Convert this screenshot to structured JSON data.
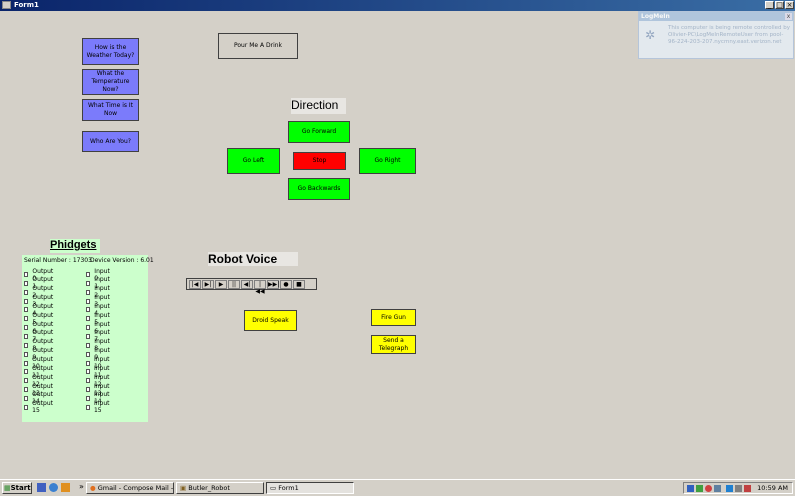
{
  "window": {
    "title": "Form1",
    "min": "_",
    "max": "□",
    "close": "×"
  },
  "menu_buttons": {
    "weather": "How is the Weather Today?",
    "temperature": "What the Temperature Now?",
    "time": "What Time is It Now",
    "who": "Who Are You?",
    "drink": "Pour Me A Drink"
  },
  "direction": {
    "heading": "Direction",
    "forward": "Go Forward",
    "left": "Go Left",
    "stop": "Stop",
    "right": "Go Right",
    "backward": "Go Backwards"
  },
  "phidgets": {
    "heading": "Phidgets",
    "serial": "Serial Number : 17303",
    "version": "Device Version : 6.01",
    "outputs": [
      "Output 0",
      "Output 1",
      "Output 2",
      "Output 3",
      "Output 4",
      "Output 5",
      "Output 6",
      "Output 7",
      "Output 8",
      "Output 9",
      "Output 10",
      "Output 11",
      "Output 12",
      "Output 13",
      "Output 14",
      "Output 15"
    ],
    "inputs": [
      "Input 0",
      "Input 1",
      "Input 2",
      "Input 3",
      "Input 4",
      "Input 5",
      "Input 6",
      "Input 7",
      "Input 8",
      "Input 9",
      "Input 10",
      "Input 11",
      "Input 12",
      "Input 13",
      "Input 14",
      "Input 15"
    ]
  },
  "voice": {
    "heading": "Robot Voice",
    "media_buttons": [
      "|◀",
      "▶|",
      "▶",
      "||",
      "◀|",
      "|◀◀",
      "▶▶|",
      "●",
      "■"
    ],
    "droid": "Droid Speak"
  },
  "actions": {
    "fire": "Fire Gun",
    "telegraph": "Send a Telegraph"
  },
  "logmein": {
    "title": "LogMeIn",
    "close": "x",
    "message": "This computer is being remote controlled by Olivier-PC\\LogMeInRemoteUser from pool-96-224-203-207.nycmny.east.verizon.net"
  },
  "taskbar": {
    "start": "Start",
    "chevron": "»",
    "items": [
      "Gmail - Compose Mail - ai...",
      "Butler_Robot",
      "Form1"
    ],
    "clock": "10:59 AM"
  }
}
